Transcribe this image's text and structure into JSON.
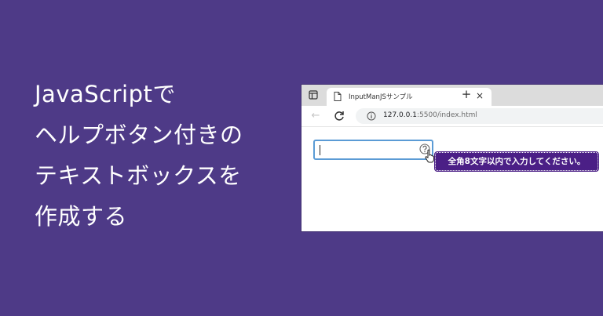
{
  "headline": {
    "lines": [
      "JavaScriptで",
      "ヘルプボタン付きの",
      "テキストボックスを",
      "作成する"
    ]
  },
  "browser": {
    "tab_title": "InputManJSサンプル",
    "close_glyph": "×",
    "new_tab_glyph": "+",
    "back_glyph": "←",
    "url_host": "127.0.0.1",
    "url_rest": ":5500/index.html"
  },
  "content": {
    "input_value": "",
    "help_tooltip": "全角8文字以内で入力してください。"
  },
  "colors": {
    "background": "#4e3a87",
    "tooltip": "#4b1f86",
    "input_border": "#5b9bd5"
  },
  "icons": [
    "sidebar-toggle-icon",
    "page-icon",
    "close-icon",
    "plus-icon",
    "back-arrow-icon",
    "reload-icon",
    "info-icon",
    "help-icon",
    "pointer-hand-icon"
  ]
}
